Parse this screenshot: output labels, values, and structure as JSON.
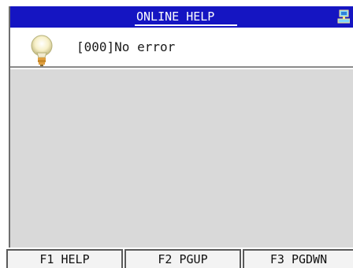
{
  "header": {
    "title": "ONLINE HELP",
    "icon": "network-icon",
    "color": "#1515c2"
  },
  "message": {
    "icon": "lightbulb-icon",
    "text": "[000]No error"
  },
  "help_pane": {
    "background": "#d9d9d9"
  },
  "function_keys": [
    {
      "label": "F1 HELP"
    },
    {
      "label": "F2 PGUP"
    },
    {
      "label": "F3 PGDWN"
    }
  ]
}
